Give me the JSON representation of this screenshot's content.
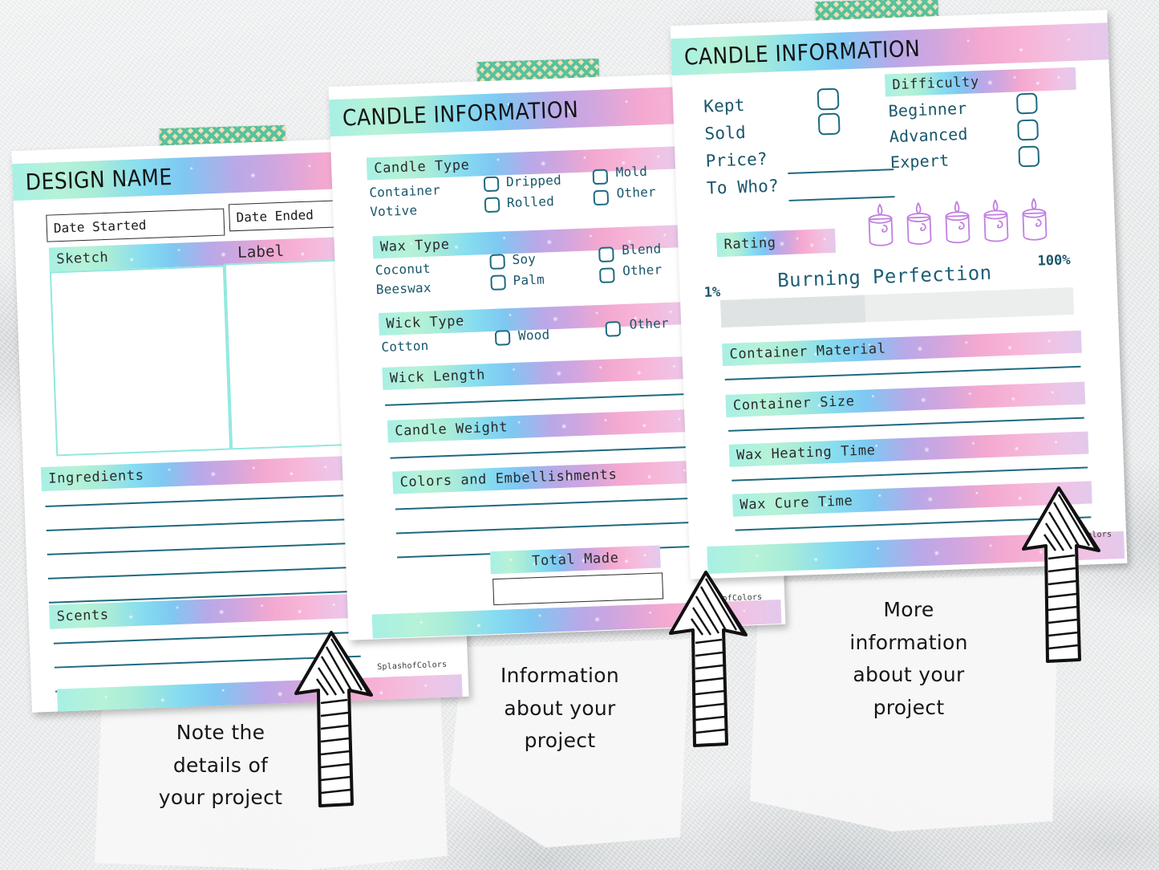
{
  "background": {
    "texture": "watercolor-gray-paper",
    "base_color": "#eceeef"
  },
  "palette": {
    "gradient_start": "#a8f0e4",
    "gradient_mid_blue": "#7ec8f2",
    "gradient_mid_purple": "#b9a8e8",
    "gradient_end_pink": "#f3a8d0",
    "ink": "#19566b",
    "candle_outline": "#c07fe0",
    "washi_tape_green": "#4cbf96",
    "washi_tape_cream": "#f0dfb4"
  },
  "pages": [
    {
      "id": "design-name-page",
      "title": "DESIGN NAME",
      "fields": {
        "date_started": "Date Started",
        "date_ended": "Date Ended",
        "sketch": "Sketch",
        "label": "Label",
        "ingredients": "Ingredients",
        "scents": "Scents"
      },
      "ingredient_line_count": 5,
      "scent_line_count": 4,
      "watermark": "SplashofColors"
    },
    {
      "id": "candle-information-page-2",
      "title": "CANDLE INFORMATION",
      "sections": [
        {
          "label": "Candle Type",
          "rows": [
            {
              "left": "Container",
              "mid": "Dripped",
              "right": "Mold"
            },
            {
              "left": "Votive",
              "mid": "Rolled",
              "right": "Other"
            }
          ]
        },
        {
          "label": "Wax Type",
          "rows": [
            {
              "left": "Coconut",
              "mid": "Soy",
              "right": "Blend"
            },
            {
              "left": "Beeswax",
              "mid": "Palm",
              "right": "Other"
            }
          ]
        },
        {
          "label": "Wick Type",
          "rows": [
            {
              "left": "Cotton",
              "mid": "Wood",
              "right": "Other"
            }
          ]
        }
      ],
      "write_in_sections": [
        {
          "label": "Wick Length",
          "lines": 1
        },
        {
          "label": "Candle Weight",
          "lines": 1
        },
        {
          "label": "Colors and Embellishments",
          "lines": 4
        }
      ],
      "total_made": {
        "label": "Total Made",
        "value": ""
      },
      "watermark": "SplashofColors"
    },
    {
      "id": "candle-information-page-3",
      "title": "CANDLE INFORMATION",
      "disposition": {
        "items": [
          "Kept",
          "Sold"
        ],
        "price_label": "Price?",
        "price_value": "",
        "to_who_label": "To Who?",
        "to_who_value": ""
      },
      "difficulty": {
        "label": "Difficulty",
        "options": [
          "Beginner",
          "Advanced",
          "Expert"
        ]
      },
      "rating": {
        "label": "Rating",
        "candle_count": 5
      },
      "burning_perfection": {
        "label": "Burning Perfection",
        "min": "1%",
        "max": "100%",
        "fill_percent": 41
      },
      "write_in_sections": [
        {
          "label": "Container Material",
          "lines": 1
        },
        {
          "label": "Container Size",
          "lines": 1
        },
        {
          "label": "Wax Heating Time",
          "lines": 1
        },
        {
          "label": "Wax Cure Time",
          "lines": 1
        }
      ],
      "watermark": "SplashofColors"
    }
  ],
  "captions": [
    {
      "id": "caption-left",
      "text": "Note the\ndetails of\nyour project"
    },
    {
      "id": "caption-middle",
      "text": "Information\nabout your\nproject"
    },
    {
      "id": "caption-right",
      "text": "More\ninformation\nabout your\nproject"
    }
  ]
}
